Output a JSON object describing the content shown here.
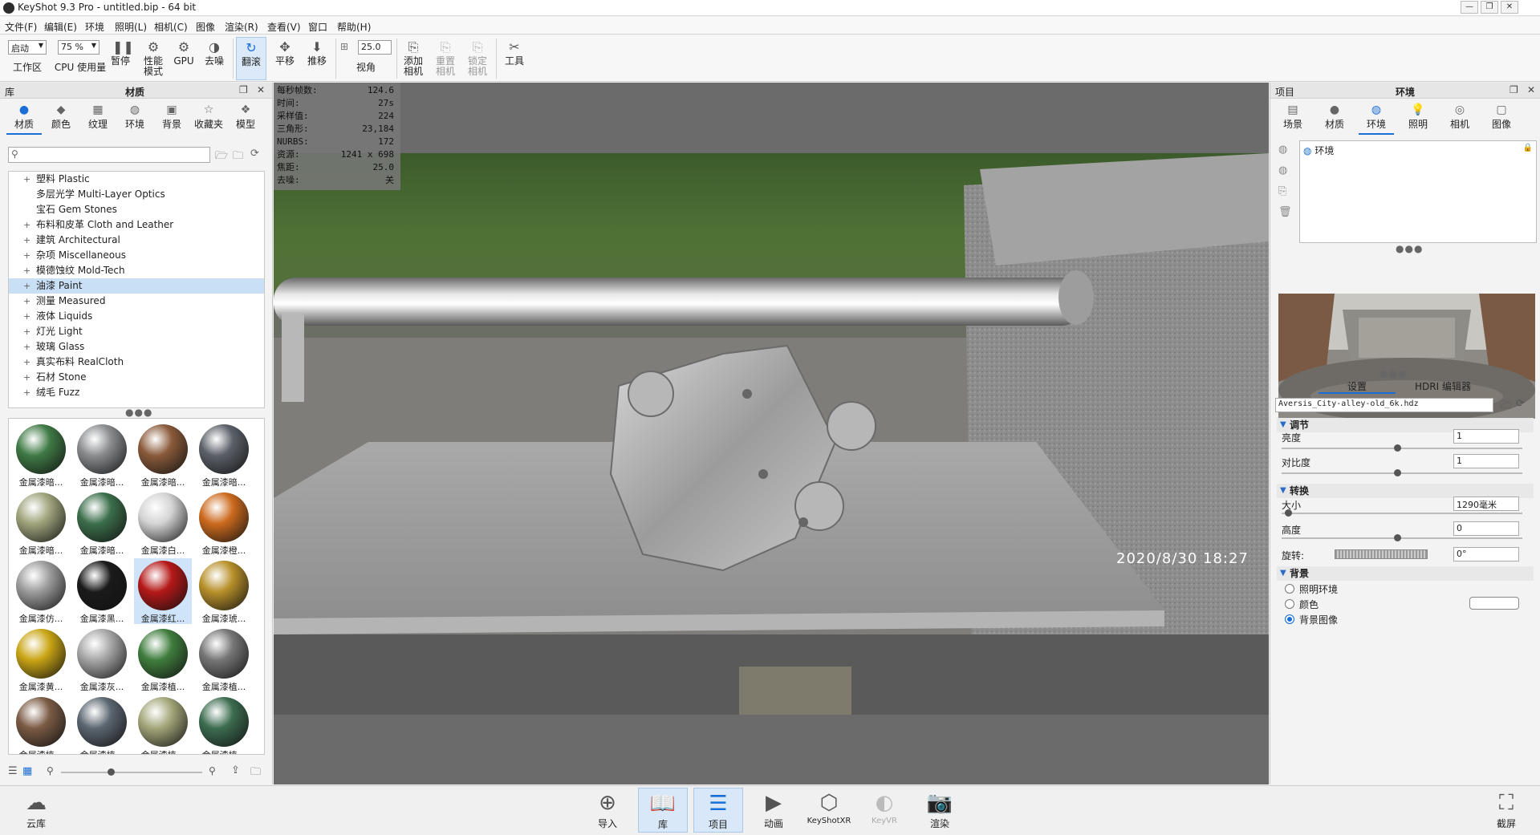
{
  "window": {
    "title": "KeyShot 9.3 Pro  - untitled.bip  - 64 bit",
    "controls": [
      "—",
      "❐",
      "✕"
    ]
  },
  "menu": [
    "文件(F)",
    "编辑(E)",
    "环境",
    "照明(L)",
    "相机(C)",
    "图像",
    "渲染(R)",
    "查看(V)",
    "窗口",
    "帮助(H)"
  ],
  "toolbar": {
    "mode_dropdown": "启动",
    "cpu_dropdown": "75 %",
    "workspace": "工作区",
    "cpu_usage": "CPU 使用量",
    "pause": "暂停",
    "perf_mode": "性能\n模式",
    "gpu": "GPU",
    "denoise": "去噪",
    "tumble": "翻滚",
    "pan": "平移",
    "dolly": "推移",
    "fov_value": "25.0",
    "fov": "视角",
    "add_camera": "添加\n相机",
    "reset_camera": "重置\n相机",
    "lock_camera": "锁定\n相机",
    "tools": "工具"
  },
  "library": {
    "header": "库",
    "title": "材质",
    "tabs": [
      {
        "label": "材质",
        "icon": "material-icon"
      },
      {
        "label": "颜色",
        "icon": "color-icon"
      },
      {
        "label": "纹理",
        "icon": "texture-icon"
      },
      {
        "label": "环境",
        "icon": "environment-icon"
      },
      {
        "label": "背景",
        "icon": "background-icon"
      },
      {
        "label": "收藏夹",
        "icon": "favorites-icon"
      },
      {
        "label": "模型",
        "icon": "model-icon"
      }
    ],
    "tree": [
      {
        "label": "塑料 Plastic",
        "expandable": true
      },
      {
        "label": "多层光学 Multi-Layer Optics",
        "expandable": false
      },
      {
        "label": "宝石 Gem Stones",
        "expandable": false
      },
      {
        "label": "布料和皮革 Cloth and Leather",
        "expandable": true
      },
      {
        "label": "建筑 Architectural",
        "expandable": true
      },
      {
        "label": "杂项 Miscellaneous",
        "expandable": true
      },
      {
        "label": "模德蚀纹 Mold-Tech",
        "expandable": true
      },
      {
        "label": "油漆 Paint",
        "expandable": true,
        "selected": true
      },
      {
        "label": "测量 Measured",
        "expandable": true
      },
      {
        "label": "液体 Liquids",
        "expandable": true
      },
      {
        "label": "灯光 Light",
        "expandable": true
      },
      {
        "label": "玻璃 Glass",
        "expandable": true
      },
      {
        "label": "真实布料 RealCloth",
        "expandable": true
      },
      {
        "label": "石材 Stone",
        "expandable": true
      },
      {
        "label": "绒毛 Fuzz",
        "expandable": true
      }
    ],
    "materials": [
      {
        "label": "金属漆暗...",
        "color": "#3f7a45"
      },
      {
        "label": "金属漆暗...",
        "color": "#8a8c8e"
      },
      {
        "label": "金属漆暗...",
        "color": "#8a5a3a"
      },
      {
        "label": "金属漆暗...",
        "color": "#5b6068"
      },
      {
        "label": "金属漆暗...",
        "color": "#9fa47c"
      },
      {
        "label": "金属漆暗...",
        "color": "#3b6e4b"
      },
      {
        "label": "金属漆白...",
        "color": "#d4d4d4"
      },
      {
        "label": "金属漆橙...",
        "color": "#cc6a1e"
      },
      {
        "label": "金属漆仿...",
        "color": "#9c9c9c"
      },
      {
        "label": "金属漆黑...",
        "color": "#1a1a1a"
      },
      {
        "label": "金属漆红...",
        "color": "#b51818",
        "selected": true
      },
      {
        "label": "金属漆琥...",
        "color": "#b8902a"
      },
      {
        "label": "金属漆黄...",
        "color": "#c9a514"
      },
      {
        "label": "金属漆灰...",
        "color": "#a7a7a7"
      },
      {
        "label": "金属漆植...",
        "color": "#3f7d3d"
      },
      {
        "label": "金属漆植...",
        "color": "#767676"
      },
      {
        "label": "金属漆植...",
        "color": "#7a5a44"
      },
      {
        "label": "金属漆植...",
        "color": "#5b6670"
      },
      {
        "label": "金属漆植...",
        "color": "#a3a679"
      },
      {
        "label": "金属漆植...",
        "color": "#3c6c50"
      }
    ]
  },
  "viewport": {
    "stats": [
      {
        "k": "每秒帧数:",
        "v": "124.6"
      },
      {
        "k": "时间:",
        "v": "27s"
      },
      {
        "k": "采样值:",
        "v": "224"
      },
      {
        "k": "三角形:",
        "v": "23,184"
      },
      {
        "k": "NURBS:",
        "v": "172"
      },
      {
        "k": "资源:",
        "v": "1241 x 698"
      },
      {
        "k": "焦距:",
        "v": "25.0"
      },
      {
        "k": "去噪:",
        "v": "关"
      }
    ],
    "datestamp": "2020/8/30  18:27"
  },
  "project": {
    "header": "项目",
    "title": "环境",
    "tabs": [
      {
        "label": "场景",
        "icon": "scene-icon"
      },
      {
        "label": "材质",
        "icon": "material-icon"
      },
      {
        "label": "环境",
        "icon": "environment-icon"
      },
      {
        "label": "照明",
        "icon": "lighting-icon"
      },
      {
        "label": "相机",
        "icon": "camera-icon"
      },
      {
        "label": "图像",
        "icon": "image-icon"
      }
    ],
    "env_item": "环境",
    "subtabs": [
      "设置",
      "HDRI 编辑器"
    ],
    "hdri_file": "Aversis_City-alley-old_6k.hdz",
    "adjust": {
      "title": "调节",
      "brightness_label": "亮度",
      "brightness": "1",
      "contrast_label": "对比度",
      "contrast": "1"
    },
    "transform": {
      "title": "转换",
      "size_label": "大小",
      "size": "1290毫米",
      "height_label": "高度",
      "height": "0",
      "rotation_label": "旋转:",
      "rotation": "0°"
    },
    "background": {
      "title": "背景",
      "options": [
        "照明环境",
        "颜色",
        "背景图像"
      ],
      "selected": "背景图像",
      "color": "#ffffff"
    }
  },
  "bottombar": {
    "cloud": "云库",
    "items": [
      {
        "label": "导入",
        "icon": "import-icon"
      },
      {
        "label": "库",
        "icon": "library-icon",
        "active": true
      },
      {
        "label": "项目",
        "icon": "project-icon",
        "active": true
      },
      {
        "label": "动画",
        "icon": "animation-icon"
      },
      {
        "label": "KeyShotXR",
        "icon": "keyshotxr-icon"
      },
      {
        "label": "KeyVR",
        "icon": "keyvr-icon",
        "disabled": true
      },
      {
        "label": "渲染",
        "icon": "render-icon"
      }
    ],
    "screenshot": "截屏"
  },
  "colors": {
    "accent": "#1a6fd6",
    "selection": "#c8dff5"
  }
}
